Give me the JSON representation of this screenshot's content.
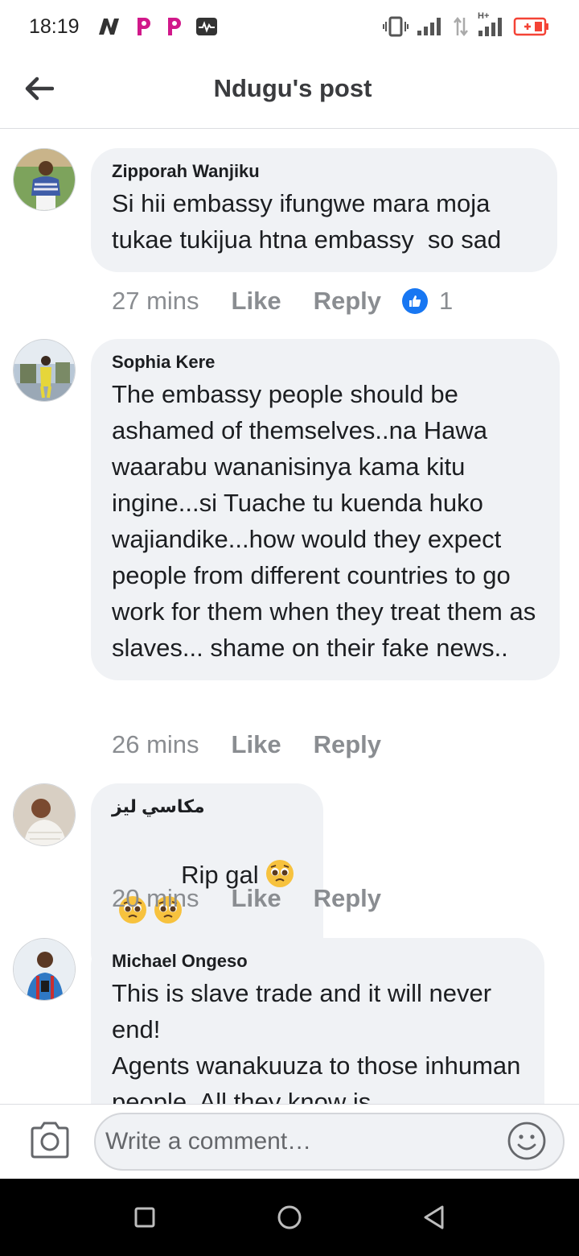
{
  "status_bar": {
    "time": "18:19",
    "left_icons": [
      "n-app-icon",
      "p-app-icon",
      "p-app-icon-2",
      "pulse-icon"
    ],
    "right_icons": [
      "vibrate-icon",
      "signal-icon",
      "data-arrows-icon",
      "h-plus-signal-icon",
      "battery-charging-icon"
    ],
    "network_label": "H+"
  },
  "header": {
    "title": "Ndugu's post",
    "back_icon": "back-arrow-icon"
  },
  "comments": [
    {
      "author": "Zipporah Wanjiku",
      "text": "Si hii embassy ifungwe mara moja tukae tukijua htna embassy  so sad",
      "time": "27 mins",
      "like_label": "Like",
      "reply_label": "Reply",
      "reaction_count": "1"
    },
    {
      "author": "Sophia Kere",
      "text": "The embassy people should be ashamed of themselves..na Hawa waarabu wananisinya kama kitu ingine...si Tuache tu kuenda huko wajiandike...how would they expect people from different countries to go work for them when they treat them as slaves... shame on their fake news..",
      "time": "26 mins",
      "like_label": "Like",
      "reply_label": "Reply"
    },
    {
      "author": "مكاسي ليز",
      "text": "Rip gal",
      "emojis": [
        "pleading-face",
        "pleading-face",
        "pleading-face"
      ],
      "time": "20 mins",
      "like_label": "Like",
      "reply_label": "Reply"
    },
    {
      "author": "Michael Ongeso",
      "text": "This is slave trade and it will never end!\nAgents wanakuuza to those inhuman people. All they know is"
    }
  ],
  "composer": {
    "placeholder": "Write a comment…",
    "camera_icon": "camera-icon",
    "emoji_icon": "smiley-icon"
  },
  "nav": {
    "buttons": [
      "recent-apps-icon",
      "home-icon",
      "back-icon"
    ]
  },
  "colors": {
    "bubble": "#f0f2f5",
    "meta_text": "#8a8d91",
    "like_blue": "#1877f2",
    "battery_red": "#f44336"
  }
}
